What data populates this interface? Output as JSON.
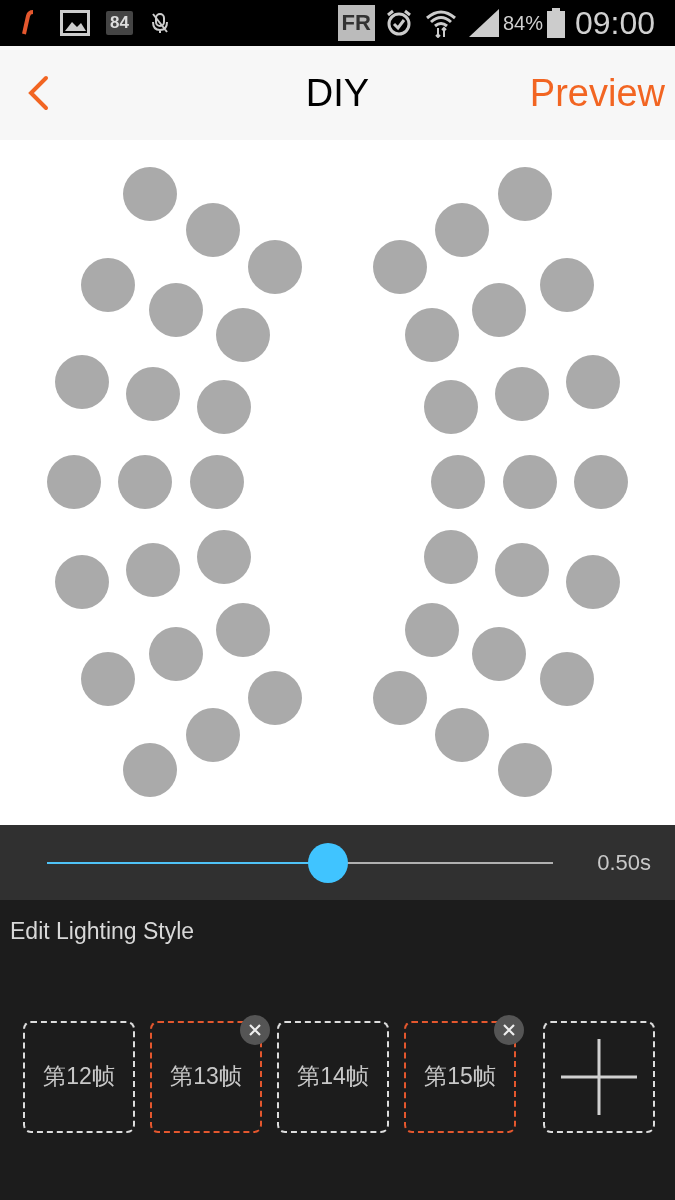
{
  "status_bar": {
    "badge": "84",
    "language": "FR",
    "battery": "84%",
    "time": "09:00"
  },
  "header": {
    "title": "DIY",
    "action": "Preview"
  },
  "speed": {
    "level": 0.555,
    "reading": "0.50s"
  },
  "section_title": "Edit Lighting Style",
  "frames": [
    {
      "label": "第12帧",
      "selected": false
    },
    {
      "label": "第13帧",
      "selected": true
    },
    {
      "label": "第14帧",
      "selected": false
    },
    {
      "label": "第15帧",
      "selected": true
    }
  ]
}
